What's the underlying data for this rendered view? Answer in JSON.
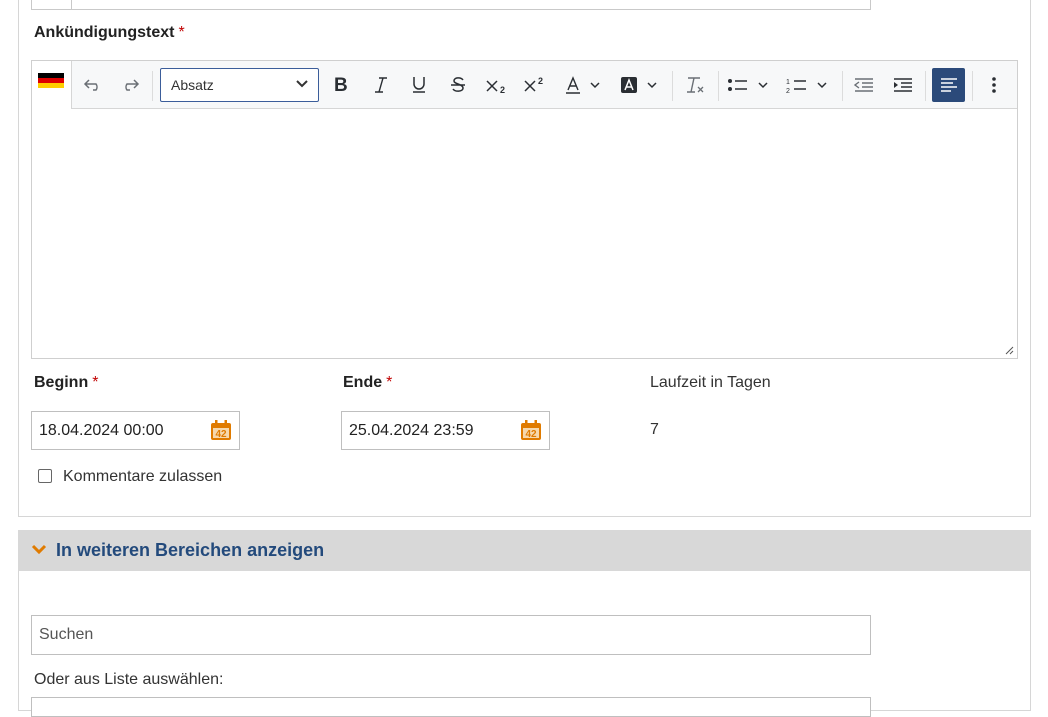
{
  "announcement": {
    "label": "Ankündigungstext",
    "required_marker": "*",
    "language_flag": "de-flag-icon",
    "toolbar": {
      "format_select_value": "Absatz",
      "tools": [
        "undo-icon",
        "redo-icon",
        "bold-icon",
        "italic-icon",
        "underline-icon",
        "strikethrough-icon",
        "subscript-icon",
        "superscript-icon",
        "text-color-icon",
        "highlight-color-icon",
        "clear-formatting-icon",
        "bullet-list-icon",
        "numbered-list-icon",
        "outdent-icon",
        "indent-icon",
        "align-left-icon",
        "more-icon"
      ]
    },
    "content": ""
  },
  "dates": {
    "begin_label": "Beginn",
    "begin_value": "18.04.2024 00:00",
    "end_label": "Ende",
    "end_value": "25.04.2024 23:59",
    "calendar_badge": "42",
    "duration_label": "Laufzeit in Tagen",
    "duration_value": "7"
  },
  "comments": {
    "label": "Kommentare zulassen",
    "checked": false
  },
  "other_areas": {
    "title": "In weiteren Bereichen anzeigen",
    "search_placeholder": "Suchen",
    "or_label": "Oder aus Liste auswählen:"
  },
  "colors": {
    "required": "#c00000",
    "accent": "#2b4a7a",
    "section_title": "#234a7c",
    "calendar": "#e07b00",
    "section_bg": "#d8d8d8"
  }
}
